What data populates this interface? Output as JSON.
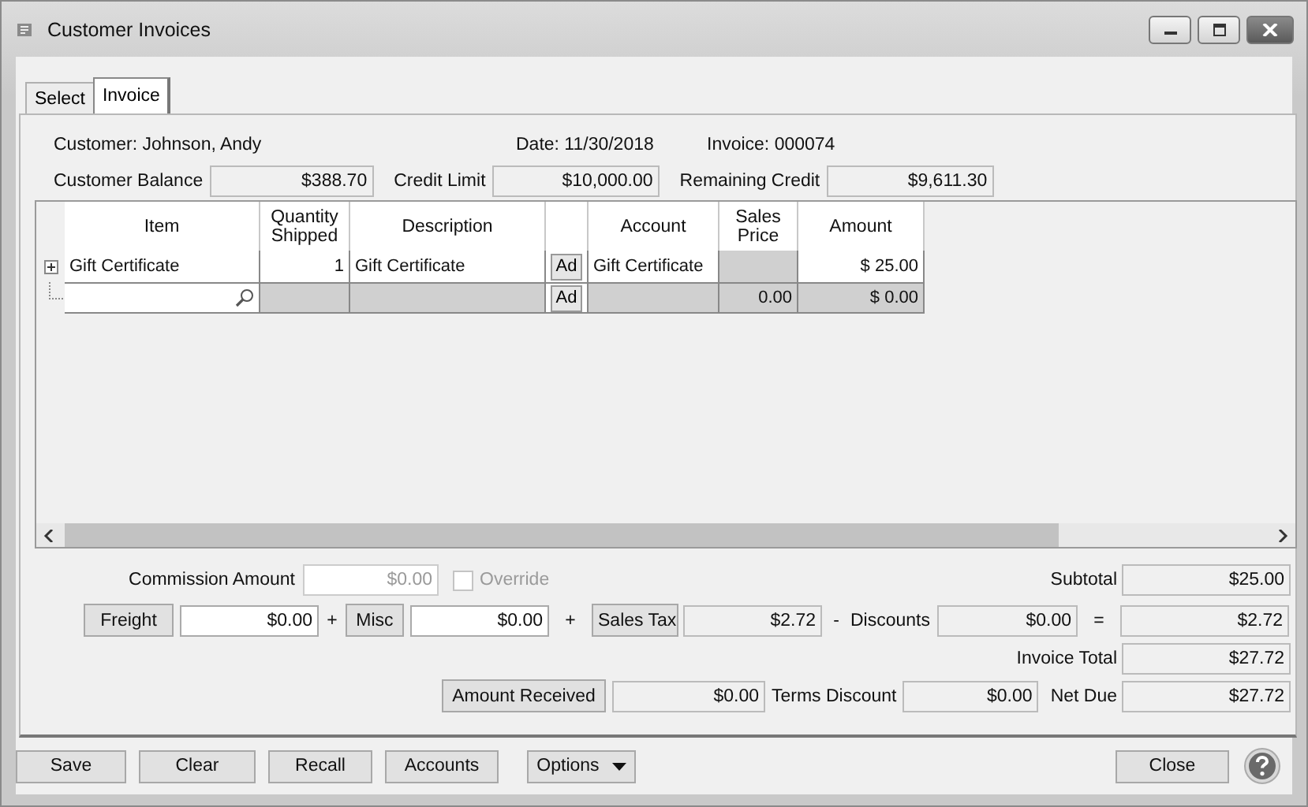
{
  "window": {
    "title": "Customer Invoices"
  },
  "tabs": [
    {
      "label": "Select",
      "selected": false
    },
    {
      "label": "Invoice",
      "selected": true
    }
  ],
  "header": {
    "customer": "Customer: Johnson, Andy",
    "date": "Date: 11/30/2018",
    "invoice": "Invoice: 000074"
  },
  "balances": [
    {
      "label": "Customer Balance",
      "value": "$388.70"
    },
    {
      "label": "Credit Limit",
      "value": "$10,000.00"
    },
    {
      "label": "Remaining Credit",
      "value": "$9,611.30"
    }
  ],
  "grid": {
    "columns": [
      {
        "kind": "text",
        "label": "Item"
      },
      {
        "kind": "text",
        "label": "Quantity Shipped"
      },
      {
        "kind": "text",
        "label": "Description"
      },
      {
        "kind": "blank"
      },
      {
        "kind": "text",
        "label": "Account"
      },
      {
        "kind": "text",
        "label": "Sales Price"
      },
      {
        "kind": "text",
        "label": "Amount"
      }
    ],
    "rows": [
      {
        "kind": "line",
        "expanded": false,
        "cells": [
          {
            "kind": "text",
            "text": "Gift Certificate"
          },
          {
            "kind": "number",
            "text": "1"
          },
          {
            "kind": "text",
            "text": "Gift Certificate"
          },
          {
            "kind": "button",
            "text": "Ad"
          },
          {
            "kind": "text",
            "text": "Gift Certificate"
          },
          {
            "kind": "readonly"
          },
          {
            "kind": "number",
            "text": "$ 25.00"
          }
        ]
      },
      {
        "kind": "new",
        "cells": [
          {
            "kind": "search"
          },
          {
            "kind": "readonly"
          },
          {
            "kind": "readonly"
          },
          {
            "kind": "button",
            "text": "Ad"
          },
          {
            "kind": "readonly"
          },
          {
            "kind": "readonly_number",
            "text": "0.00"
          },
          {
            "kind": "readonly_number",
            "text": "$ 0.00"
          }
        ]
      }
    ]
  },
  "commission": {
    "label": "Commission Amount",
    "value": "$0.00",
    "disabled": true
  },
  "override": {
    "label": "Override",
    "checked": false,
    "disabled": true
  },
  "subtotal": {
    "label": "Subtotal",
    "value": "$25.00"
  },
  "freight": {
    "button": "Freight",
    "value": "$0.00",
    "editable": true
  },
  "misc": {
    "operator": "+",
    "button": "Misc",
    "value": "$0.00",
    "editable": true
  },
  "sales_tax": {
    "operator": "+",
    "button": "Sales Tax",
    "value": "$2.72",
    "editable": false
  },
  "discounts": {
    "operator": "-",
    "label": "Discounts",
    "value": "$0.00"
  },
  "adjusted": {
    "operator": "=",
    "value": "$2.72"
  },
  "invoice_total": {
    "label": "Invoice Total",
    "value": "$27.72"
  },
  "amount_received": {
    "button": "Amount Received",
    "value": "$0.00",
    "editable": false
  },
  "terms_discount": {
    "label": "Terms Discount",
    "value": "$0.00"
  },
  "net_due": {
    "label": "Net Due",
    "value": "$27.72"
  },
  "footer_buttons": [
    {
      "label": "Save",
      "dropdown": false
    },
    {
      "label": "Clear",
      "dropdown": false
    },
    {
      "label": "Recall",
      "dropdown": false
    },
    {
      "label": "Accounts",
      "dropdown": false
    },
    {
      "label": "Options",
      "dropdown": true
    }
  ],
  "close_button": "Close"
}
